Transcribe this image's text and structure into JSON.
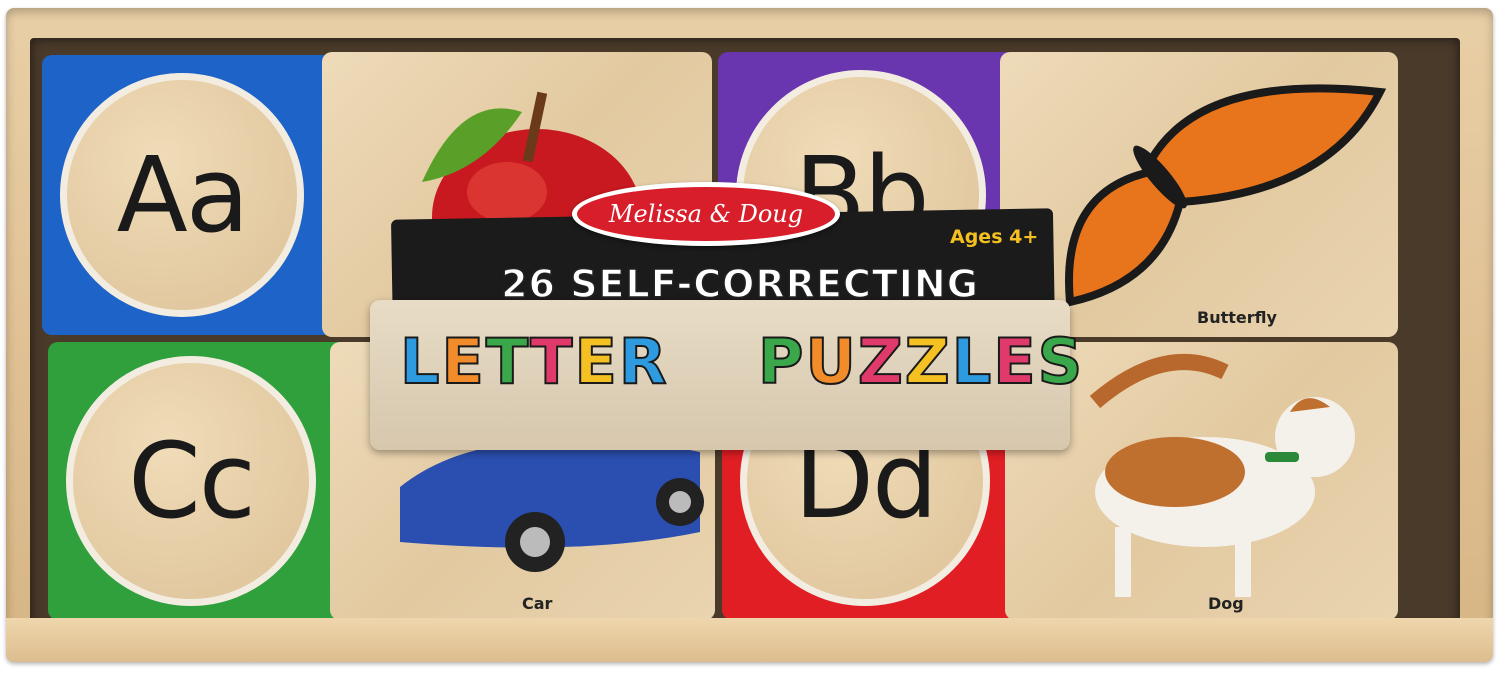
{
  "brand": "Melissa & Doug",
  "ages": "Ages 4+",
  "headline": "26 SELF-CORRECTING",
  "word_left": "LETTER",
  "word_right": "PUZZLES",
  "word_left_colors": [
    "#2e9be0",
    "#f28b2a",
    "#3aa84a",
    "#e03a6a",
    "#f5c021",
    "#2e9be0"
  ],
  "word_right_colors": [
    "#3aa84a",
    "#f28b2a",
    "#e03a6a",
    "#f5c021",
    "#2e9be0",
    "#e03a6a",
    "#3aa84a"
  ],
  "puzzles": [
    {
      "letter": "Aa",
      "word": "",
      "picture": "apple",
      "color": "#1e64c8"
    },
    {
      "letter": "Bb",
      "word": "Butterfly",
      "picture": "butterfly",
      "color": "#6a36b0"
    },
    {
      "letter": "Cc",
      "word": "Car",
      "picture": "car",
      "color": "#2fa03c"
    },
    {
      "letter": "Dd",
      "word": "Dog",
      "picture": "dog",
      "color": "#e01e24"
    }
  ]
}
